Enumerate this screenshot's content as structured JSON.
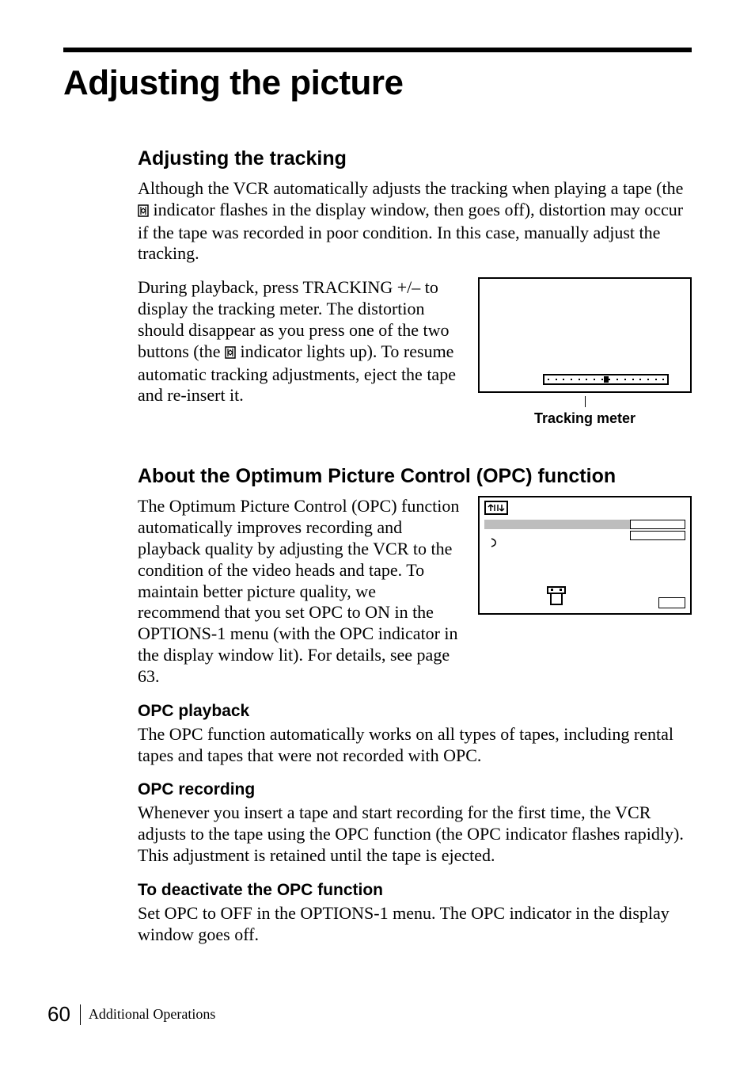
{
  "title": "Adjusting the picture",
  "tracking": {
    "heading": "Adjusting the tracking",
    "p1a": "Although the VCR automatically adjusts the tracking when playing a tape (the ",
    "p1b": " indicator flashes in the display window, then goes off), distortion may occur if the tape was recorded in poor condition. In this case, manually adjust the tracking.",
    "p2a": "During playback, press TRACKING +/– to display the tracking meter. The distortion should disappear as you press one of the two buttons (the ",
    "p2b": " indicator lights up). To resume automatic tracking adjustments, eject the tape and re-insert it.",
    "fig_label": "Tracking meter"
  },
  "opc": {
    "heading": "About the Optimum Picture Control (OPC) function",
    "intro": "The Optimum Picture Control (OPC) function automatically improves recording and playback quality by adjusting the VCR to the condition of the video heads and tape. To maintain better picture quality, we recommend that you set OPC to ON in the OPTIONS-1 menu (with the OPC indicator in the display window lit). For details, see page 63.",
    "playback_h": "OPC playback",
    "playback_p": "The OPC function automatically works on all types of tapes, including rental tapes and tapes that were not recorded with OPC.",
    "recording_h": "OPC recording",
    "recording_p": "Whenever you insert a tape and start recording for the first time, the VCR adjusts to the tape using the OPC function (the OPC indicator flashes rapidly). This adjustment is retained until the tape is ejected.",
    "deactivate_h": "To deactivate the OPC function",
    "deactivate_p": "Set OPC to OFF in the OPTIONS-1 menu. The OPC indicator in the display window goes off."
  },
  "footer": {
    "page_num": "60",
    "section": "Additional Operations"
  }
}
